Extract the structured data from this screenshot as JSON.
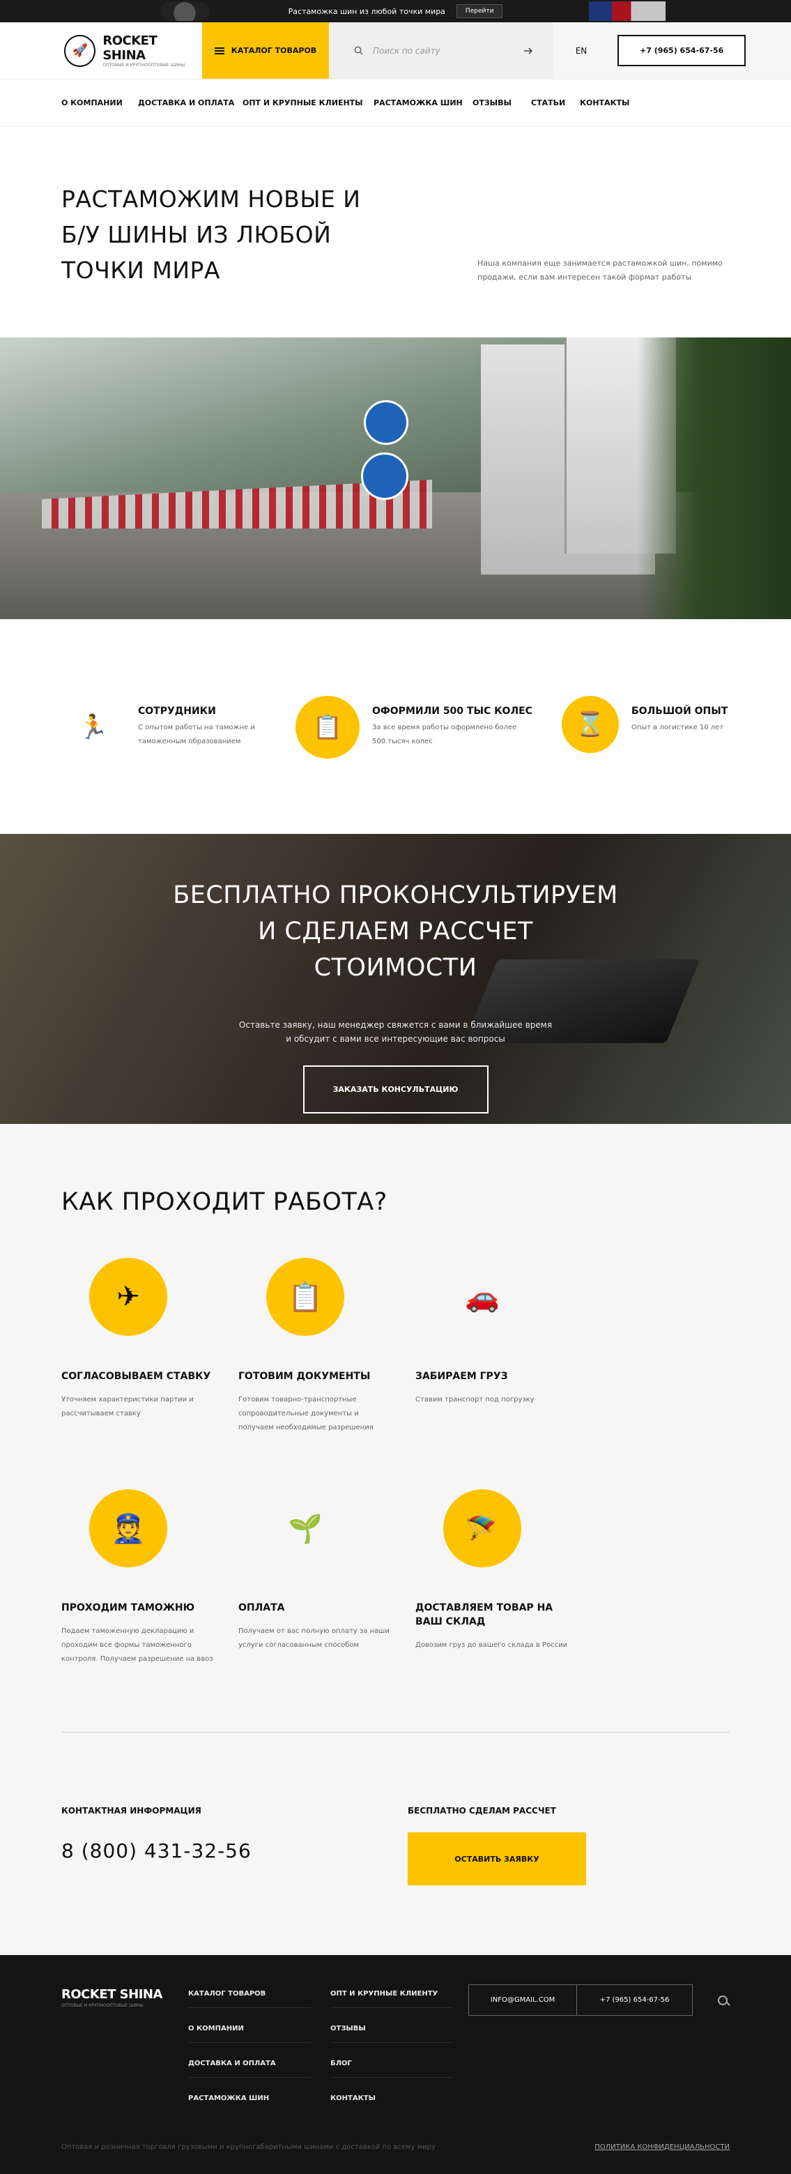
{
  "promo": {
    "text": "Растаможка шин из любой точки мира",
    "button": "Перейти"
  },
  "header": {
    "logo_name": "ROCKET SHINA",
    "logo_sub": "Оптовые и крупнооптовые шины",
    "catalog_button": "Каталог товаров",
    "search_placeholder": "Поиск по сайту",
    "lang": "EN",
    "phone": "+7 (965) 654-67-56"
  },
  "nav": [
    "О компании",
    "Доставка и оплата",
    "Опт и крупные клиенты",
    "Растаможка шин",
    "Отзывы",
    "Статьи",
    "Контакты"
  ],
  "hero": {
    "title": "РАСТАМОЖИМ НОВЫЕ И Б/У ШИНЫ ИЗ ЛЮБОЙ ТОЧКИ МИРА",
    "text": "Наша компания еще занимается растаможкой шин, помимо продажи, если вам интересен такой формат работы"
  },
  "features": [
    {
      "icon": "running-man-icon",
      "title": "Сотрудники",
      "text": "С опытом работы на таможне и таможенным образованием"
    },
    {
      "icon": "documents-icon",
      "title": "Оформили 500 тыс колес",
      "text": "За все время работы оформлено более 500 тысяч колес"
    },
    {
      "icon": "hourglass-icon",
      "title": "Большой опыт",
      "text": "Опыт в логистике 10 лет"
    }
  ],
  "consult": {
    "title": "БЕСПЛАТНО ПРОКОНСУЛЬТИРУЕМ И СДЕЛАЕМ РАССЧЕТ СТОИМОСТИ",
    "text": "Оставьте заявку, наш менеджер свяжется с вами в ближайшее время и обсудит с вами все интересующие вас вопросы",
    "button": "Заказать консультацию"
  },
  "process": {
    "title": "КАК ПРОХОДИТ РАБОТА?",
    "steps": [
      {
        "icon": "plane-coins-icon",
        "title": "Согласовываем ставку",
        "text": "Уточняем характеристики партии и рассчитываем ставку"
      },
      {
        "icon": "clipboard-icon",
        "title": "Готовим документы",
        "text": "Готовим товарно-транспортные сопроводительные документы и получаем необходимые разрешения"
      },
      {
        "icon": "car-boxes-icon",
        "title": "Забираем груз",
        "text": "Ставим транспорт под погрузку"
      },
      {
        "icon": "customs-officers-icon",
        "title": "Проходим таможню",
        "text": "Подаем таможенную декларацию и проходим все формы таможенного контроля. Получаем разрешение на ввоз"
      },
      {
        "icon": "coins-plant-icon",
        "title": "Оплата",
        "text": "Получаем от вас полную оплату за наши услуги согласованным способом"
      },
      {
        "icon": "parachute-delivery-icon",
        "title": "Доставляем товар на ваш склад",
        "text": "Довозим груз до вашего склада в России"
      }
    ]
  },
  "contact": {
    "info_label": "Контактная информация",
    "phone": "8 (800) 431-32-56",
    "free_label": "Бесплатно сделам рассчет",
    "button": "Оставить заявку"
  },
  "footer": {
    "logo_name": "ROCKET SHINA",
    "logo_sub": "Оптовые и крупнооптовые шины",
    "col1": [
      "Каталог товаров",
      "О компании",
      "Доставка и оплата",
      "Растаможка шин"
    ],
    "col2": [
      "Опт и крупные клиенту",
      "Отзывы",
      "Блог",
      "Контакты"
    ],
    "email": "info@gmail.com",
    "phone": "+7 (965) 654-67-56",
    "bottom_text": "Оптовая и розничная торговля грузовыми и крупногабаритными шинами с доставкой по всему миру",
    "policy": "Политика конфиденциальности"
  },
  "colors": {
    "accent": "#fdc300",
    "dark": "#141414",
    "light_bg": "#f6f6f6"
  }
}
